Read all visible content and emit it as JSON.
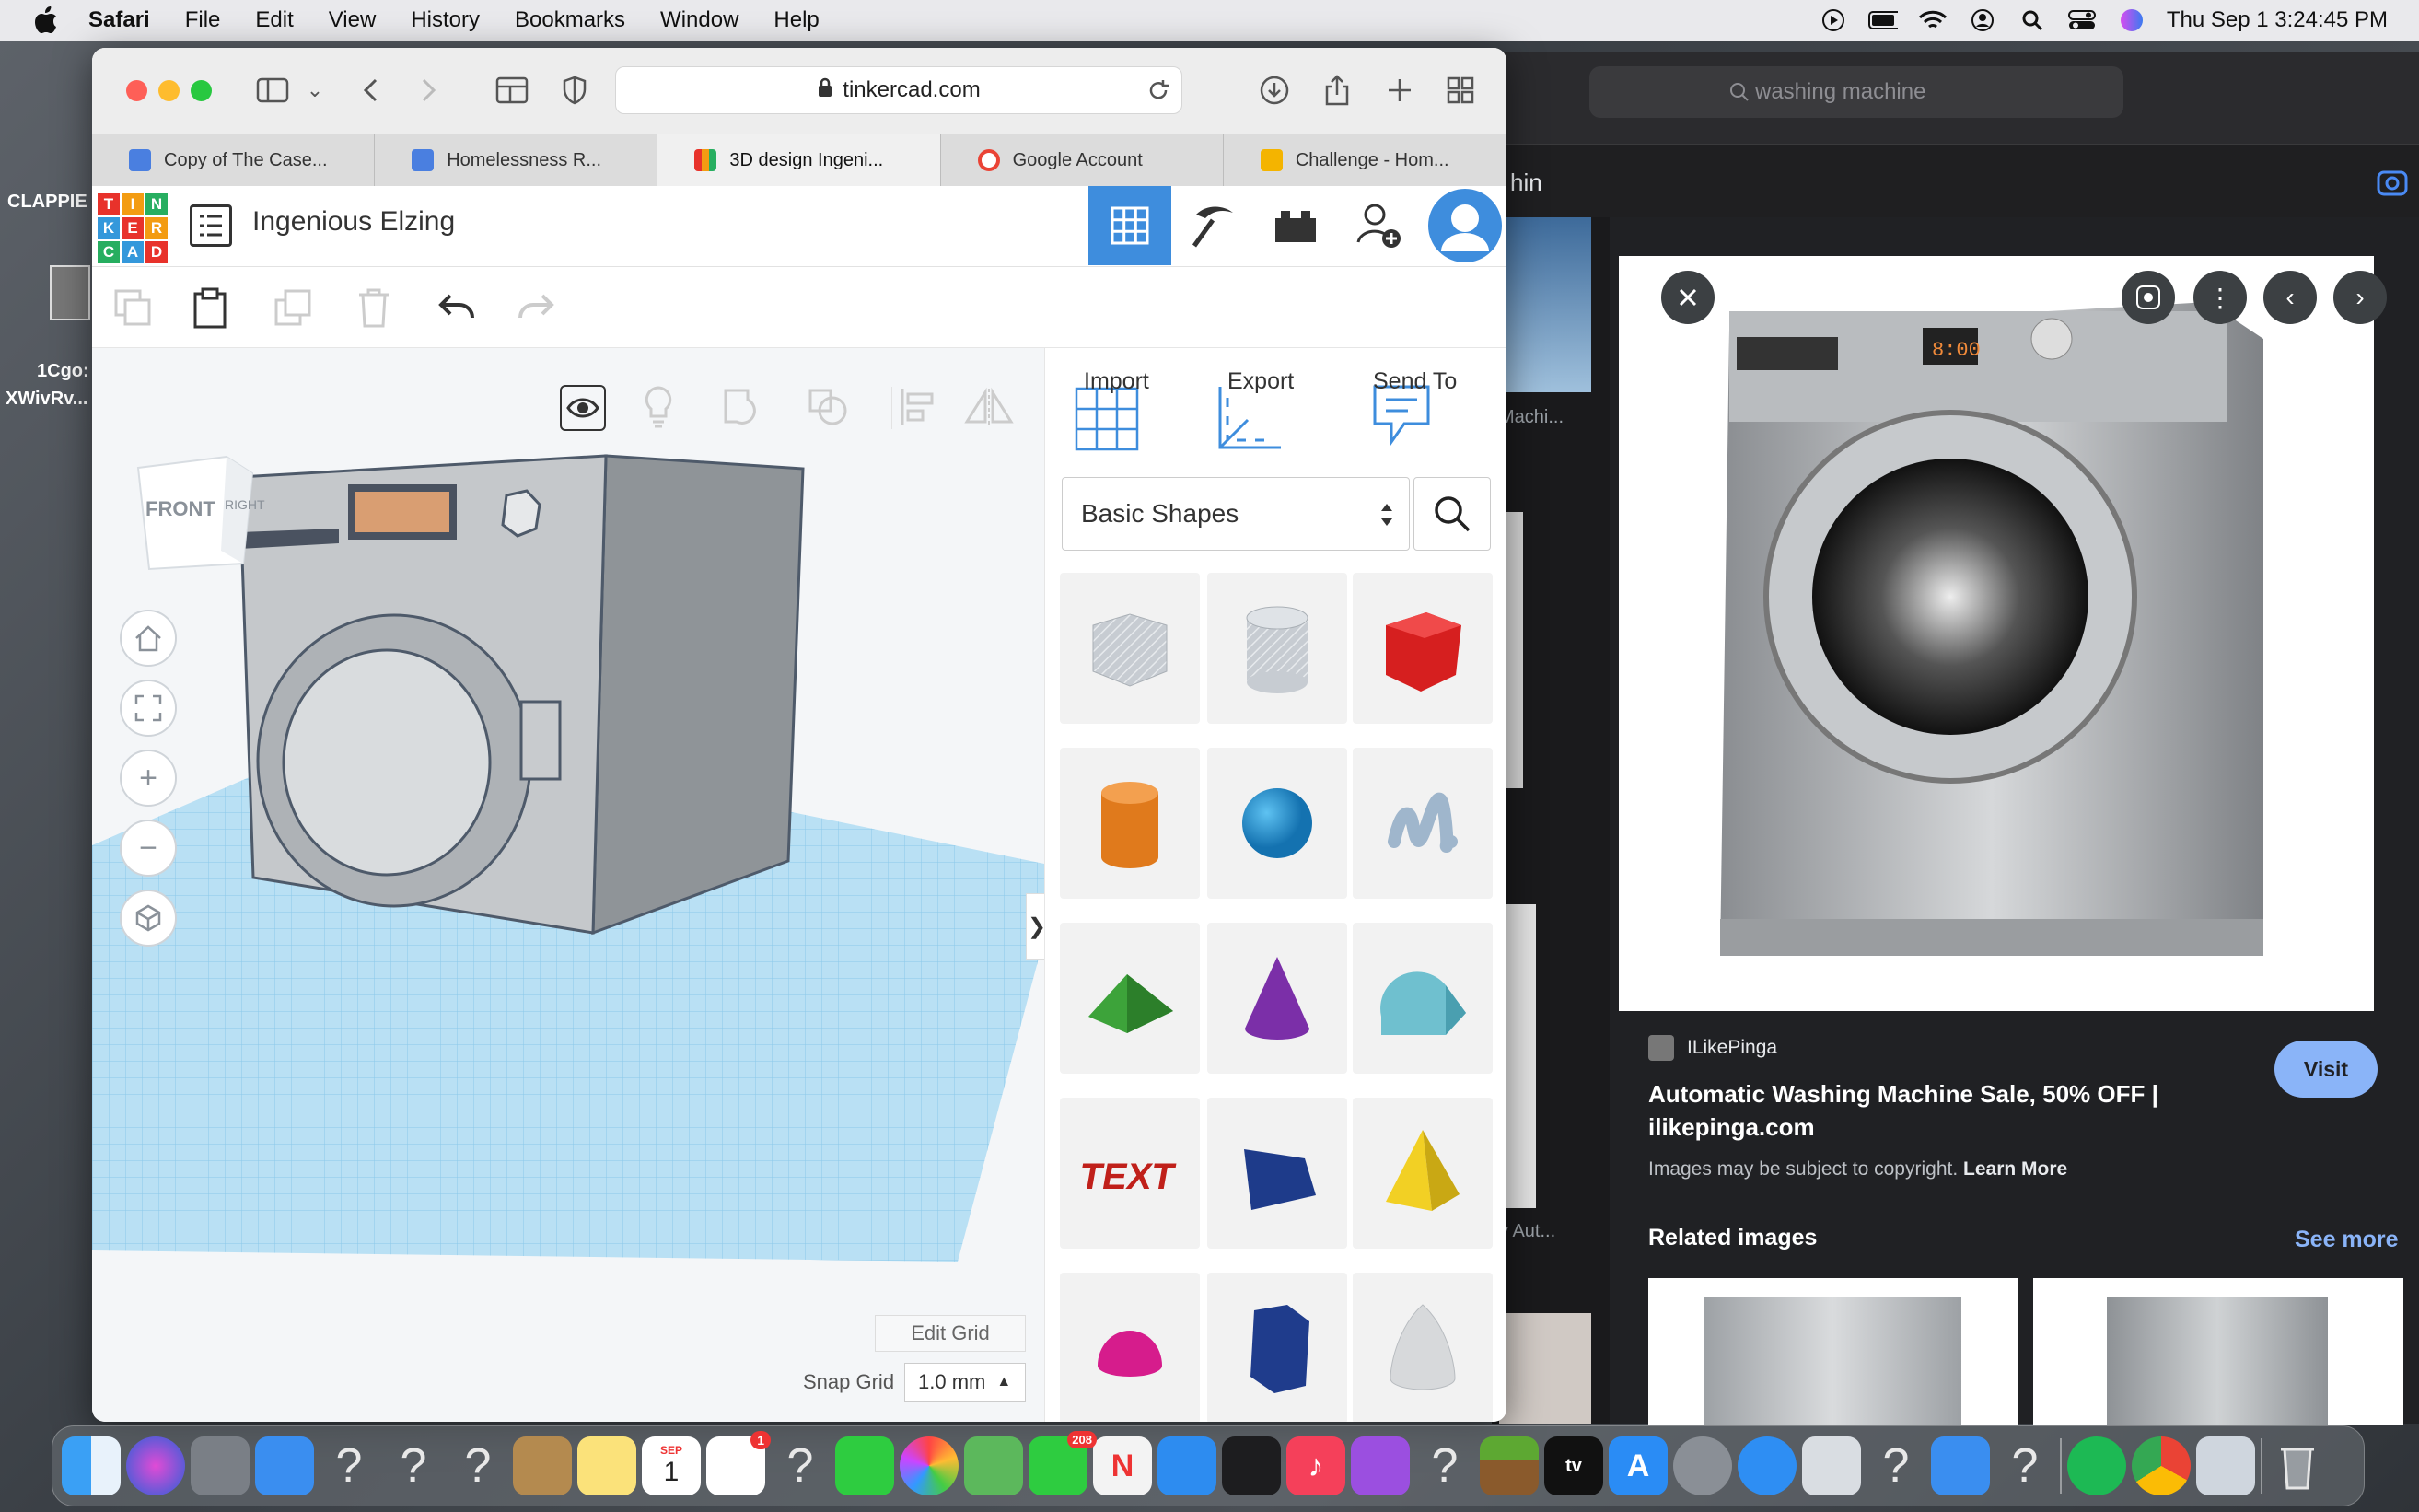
{
  "menubar": {
    "app": "Safari",
    "items": [
      "File",
      "Edit",
      "View",
      "History",
      "Bookmarks",
      "Window",
      "Help"
    ],
    "datetime": "Thu Sep 1  3:24:45 PM"
  },
  "desktop": {
    "label1": "CLAPPIE",
    "label2": "1Cgo:",
    "label3": "XWivRv..."
  },
  "browser": {
    "url": "tinkercad.com",
    "tabs": [
      {
        "label": "Copy of The Case...",
        "icon": "docs",
        "color": "#4a7fe0"
      },
      {
        "label": "Homelessness R...",
        "icon": "docs",
        "color": "#4a7fe0"
      },
      {
        "label": "3D design Ingeni...",
        "icon": "tinkercad",
        "color": "#e64a3a"
      },
      {
        "label": "Google Account",
        "icon": "google",
        "color": "#ea4335"
      },
      {
        "label": "Challenge - Hom...",
        "icon": "classroom",
        "color": "#f4b400"
      }
    ]
  },
  "tinkercad": {
    "logo_letters": [
      "T",
      "I",
      "N",
      "K",
      "E",
      "R",
      "C",
      "A",
      "D"
    ],
    "logo_colors": [
      "#e8322b",
      "#f39c12",
      "#27ae60",
      "#3498db",
      "#e8322b",
      "#f39c12",
      "#27ae60",
      "#3498db",
      "#e8322b"
    ],
    "project_name": "Ingenious Elzing",
    "import_label": "Import",
    "export_label": "Export",
    "sendto_label": "Send To",
    "library_select": "Basic Shapes",
    "edit_grid": "Edit Grid",
    "snap_grid_label": "Snap Grid",
    "snap_grid_value": "1.0 mm",
    "viewcube_front": "FRONT",
    "viewcube_right": "RIGHT",
    "collapse_arrow": "❯",
    "shapes": [
      "box-hole",
      "cylinder-hole",
      "box",
      "cylinder",
      "sphere",
      "scribble",
      "roof",
      "cone",
      "round-roof",
      "text",
      "wedge",
      "pyramid",
      "half-sphere",
      "polygon",
      "paraboloid"
    ]
  },
  "back_browser": {
    "search": "washing machine",
    "partial_title": "hin",
    "partial_label1": "Machi...",
    "partial_label2": "y Aut..."
  },
  "google_panel": {
    "source": "ILikePinga",
    "title_line1": "Automatic Washing Machine Sale, 50% OFF |",
    "title_line2": "ilikepinga.com",
    "copyright": "Images may be subject to copyright.",
    "learn_more": "Learn More",
    "visit": "Visit",
    "related": "Related images",
    "see_more": "See more",
    "display_text": "8:00"
  },
  "dock": {
    "calendar_month": "SEP",
    "calendar_day": "1",
    "reminders_badge": "1",
    "messages_badge": "208"
  }
}
